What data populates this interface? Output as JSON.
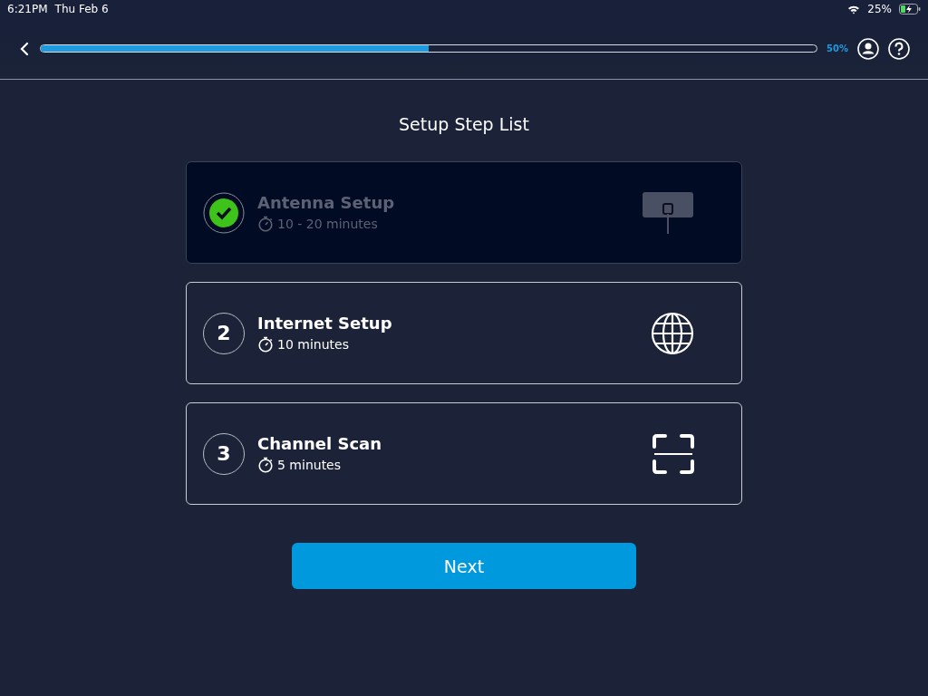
{
  "status_bar": {
    "time": "6:21PM",
    "date": "Thu Feb 6",
    "battery": "25%"
  },
  "header": {
    "progress": {
      "level": 0.5
    },
    "percent": "50%"
  },
  "title": "Setup Step List",
  "steps": [
    {
      "name": "Antenna Setup",
      "duration": "10 - 20 minutes",
      "completed": true,
      "kind": "antenna"
    },
    {
      "number": "2",
      "name": "Internet Setup",
      "duration": "10 minutes",
      "completed": false,
      "kind": "globe"
    },
    {
      "number": "3",
      "name": "Channel Scan",
      "duration": "5 minutes",
      "completed": false,
      "kind": "scan"
    }
  ],
  "next_button": "Next"
}
